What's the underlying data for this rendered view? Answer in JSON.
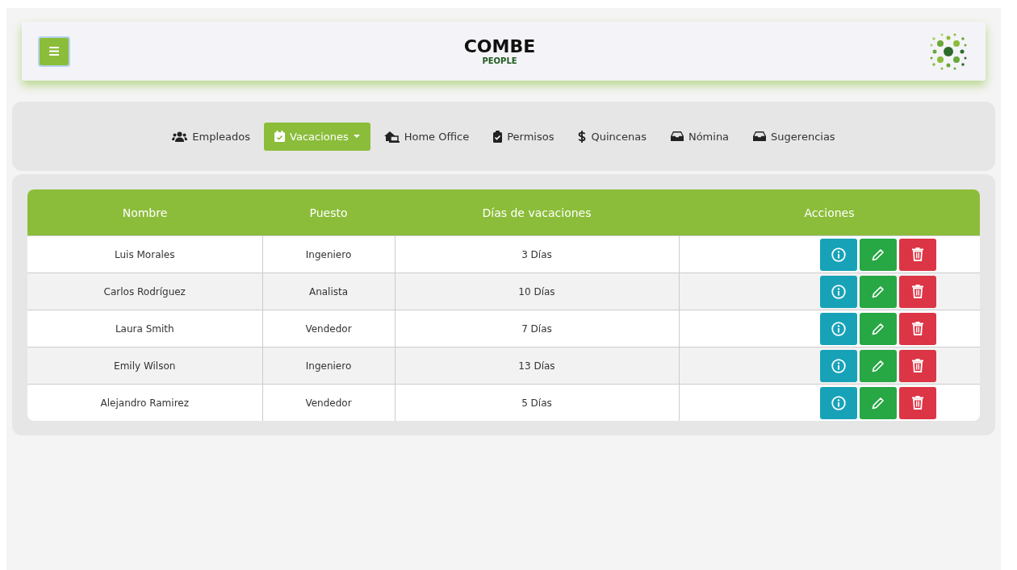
{
  "header": {
    "title": "COMBE",
    "subtitle": "PEOPLE"
  },
  "nav": [
    {
      "label": "Empleados",
      "kind": "users",
      "selected": false,
      "dropdown": false
    },
    {
      "label": "Vacaciones",
      "kind": "calendar",
      "selected": true,
      "dropdown": true
    },
    {
      "label": "Home Office",
      "kind": "house",
      "selected": false,
      "dropdown": false
    },
    {
      "label": "Permisos",
      "kind": "clipboard",
      "selected": false,
      "dropdown": false
    },
    {
      "label": "Quincenas",
      "kind": "dollar",
      "selected": false,
      "dropdown": false
    },
    {
      "label": "Nómina",
      "kind": "inbox",
      "selected": false,
      "dropdown": false
    },
    {
      "label": "Sugerencias",
      "kind": "inbox",
      "selected": false,
      "dropdown": false
    }
  ],
  "table": {
    "columns": [
      "Nombre",
      "Puesto",
      "Días de vacaciones",
      "Acciones"
    ],
    "rows": [
      {
        "nombre": "Luis Morales",
        "puesto": "Ingeniero",
        "dias": "3 Días"
      },
      {
        "nombre": "Carlos Rodríguez",
        "puesto": "Analista",
        "dias": "10 Días"
      },
      {
        "nombre": "Laura Smith",
        "puesto": "Vendedor",
        "dias": "7 Días"
      },
      {
        "nombre": "Emily Wilson",
        "puesto": "Ingeniero",
        "dias": "13 Días"
      },
      {
        "nombre": "Alejandro Ramirez",
        "puesto": "Vendedor",
        "dias": "5 Días"
      }
    ]
  }
}
